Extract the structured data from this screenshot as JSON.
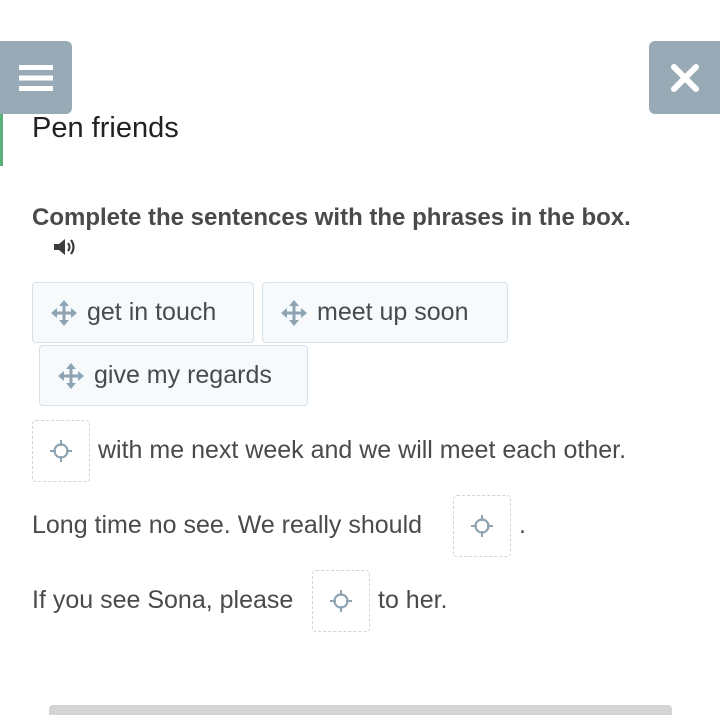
{
  "header": {
    "menu_icon": "hamburger-menu-icon",
    "close_icon": "close-x-icon"
  },
  "lesson": {
    "title": "Pen friends",
    "instruction": "Complete the sentences with the phrases in the box.",
    "audio_icon": "speaker-icon"
  },
  "phrases": [
    {
      "label": "get in touch",
      "icon": "move-icon"
    },
    {
      "label": "meet up soon",
      "icon": "move-icon"
    },
    {
      "label": "give my regards",
      "icon": "move-icon"
    }
  ],
  "sentences": [
    {
      "before": "",
      "after": "with me next week and we will meet each other."
    },
    {
      "before": "Long time no see. We really should",
      "after": "."
    },
    {
      "before": "If you see Sona, please",
      "after": "to her."
    }
  ],
  "colors": {
    "header_button": "#98aab5",
    "accent_green": "#5bb07b",
    "icon_blue": "#8ea4b3",
    "chip_bg": "#f6fafd"
  }
}
